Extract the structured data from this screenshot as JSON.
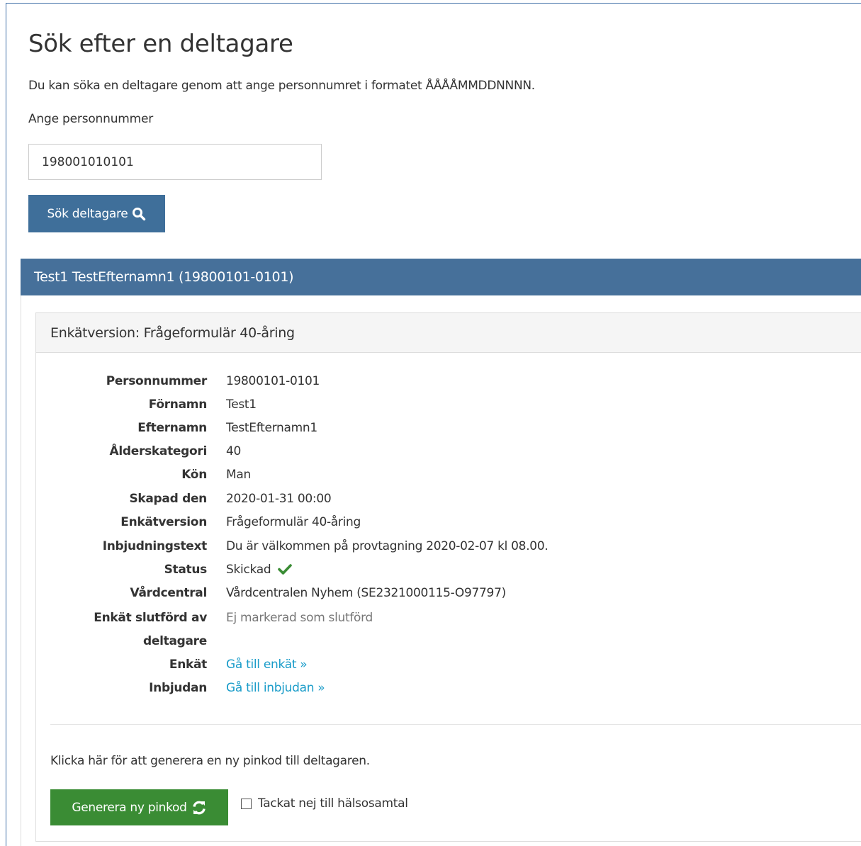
{
  "page": {
    "title": "Sök efter en deltagare",
    "intro": "Du kan söka en deltagare genom att ange personnumret i formatet ÅÅÅÅMMDDNNNN."
  },
  "search": {
    "label": "Ange personnummer",
    "value": "198001010101",
    "button_label": "Sök deltagare",
    "button_icon": "search-icon",
    "button_color": "#3f6f9a"
  },
  "participant": {
    "header": "Test1 TestEfternamn1 (19800101-0101)",
    "header_color": "#46709a",
    "survey_header": "Enkätversion: Frågeformulär 40-åring",
    "details": [
      {
        "term": "Personnummer",
        "value": "19800101-0101"
      },
      {
        "term": "Förnamn",
        "value": "Test1"
      },
      {
        "term": "Efternamn",
        "value": "TestEfternamn1"
      },
      {
        "term": "Ålderskategori",
        "value": "40"
      },
      {
        "term": "Kön",
        "value": "Man"
      },
      {
        "term": "Skapad den",
        "value": "2020-01-31 00:00"
      },
      {
        "term": "Enkätversion",
        "value": "Frågeformulär 40-åring"
      },
      {
        "term": "Inbjudningstext",
        "value": "Du är välkommen på provtagning 2020-02-07 kl 08.00."
      },
      {
        "term": "Status",
        "value": "Skickad",
        "icon": "check-icon"
      },
      {
        "term": "Vårdcentral",
        "value": "Vårdcentralen Nyhem (SE2321000115-O97797)"
      },
      {
        "term_line1": "Enkät slutförd av",
        "term_line2": "deltagare",
        "value": "Ej markerad som slutförd"
      },
      {
        "term": "Enkät",
        "value": "Gå till enkät »"
      },
      {
        "term": "Inbjudan",
        "value": "Gå till inbjudan »"
      }
    ]
  },
  "pin": {
    "text": "Klicka här för att generera en ny pinkod till deltagaren.",
    "button_label": "Generera ny pinkod",
    "button_icon": "refresh-icon",
    "button_color": "#3a8c34"
  },
  "decline": {
    "label": "Tackat nej till hälsosamtal",
    "checked": false
  }
}
